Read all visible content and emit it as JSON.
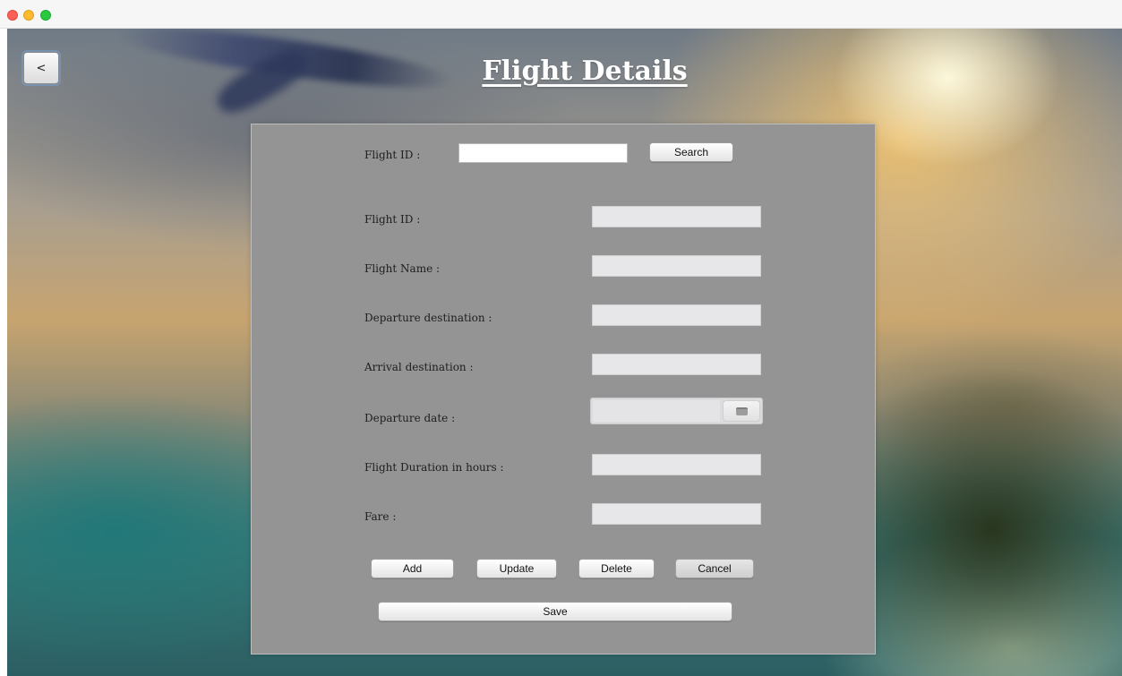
{
  "window": {
    "controls": [
      "close",
      "minimize",
      "maximize"
    ]
  },
  "header": {
    "back_label": "<",
    "title": "Flight Details"
  },
  "search": {
    "label": "Flight ID :",
    "value": "",
    "button_label": "Search"
  },
  "form": {
    "fields": [
      {
        "label": "Flight ID :",
        "value": ""
      },
      {
        "label": "Flight Name :",
        "value": ""
      },
      {
        "label": "Departure destination :",
        "value": ""
      },
      {
        "label": "Arrival destination :",
        "value": ""
      },
      {
        "label": "Departure date :",
        "value": ""
      },
      {
        "label": "Flight Duration in hours :",
        "value": ""
      },
      {
        "label": "Fare :",
        "value": ""
      }
    ],
    "date_picker_icon": "calendar-icon"
  },
  "actions": {
    "add": "Add",
    "update": "Update",
    "delete": "Delete",
    "cancel": "Cancel",
    "save": "Save"
  }
}
